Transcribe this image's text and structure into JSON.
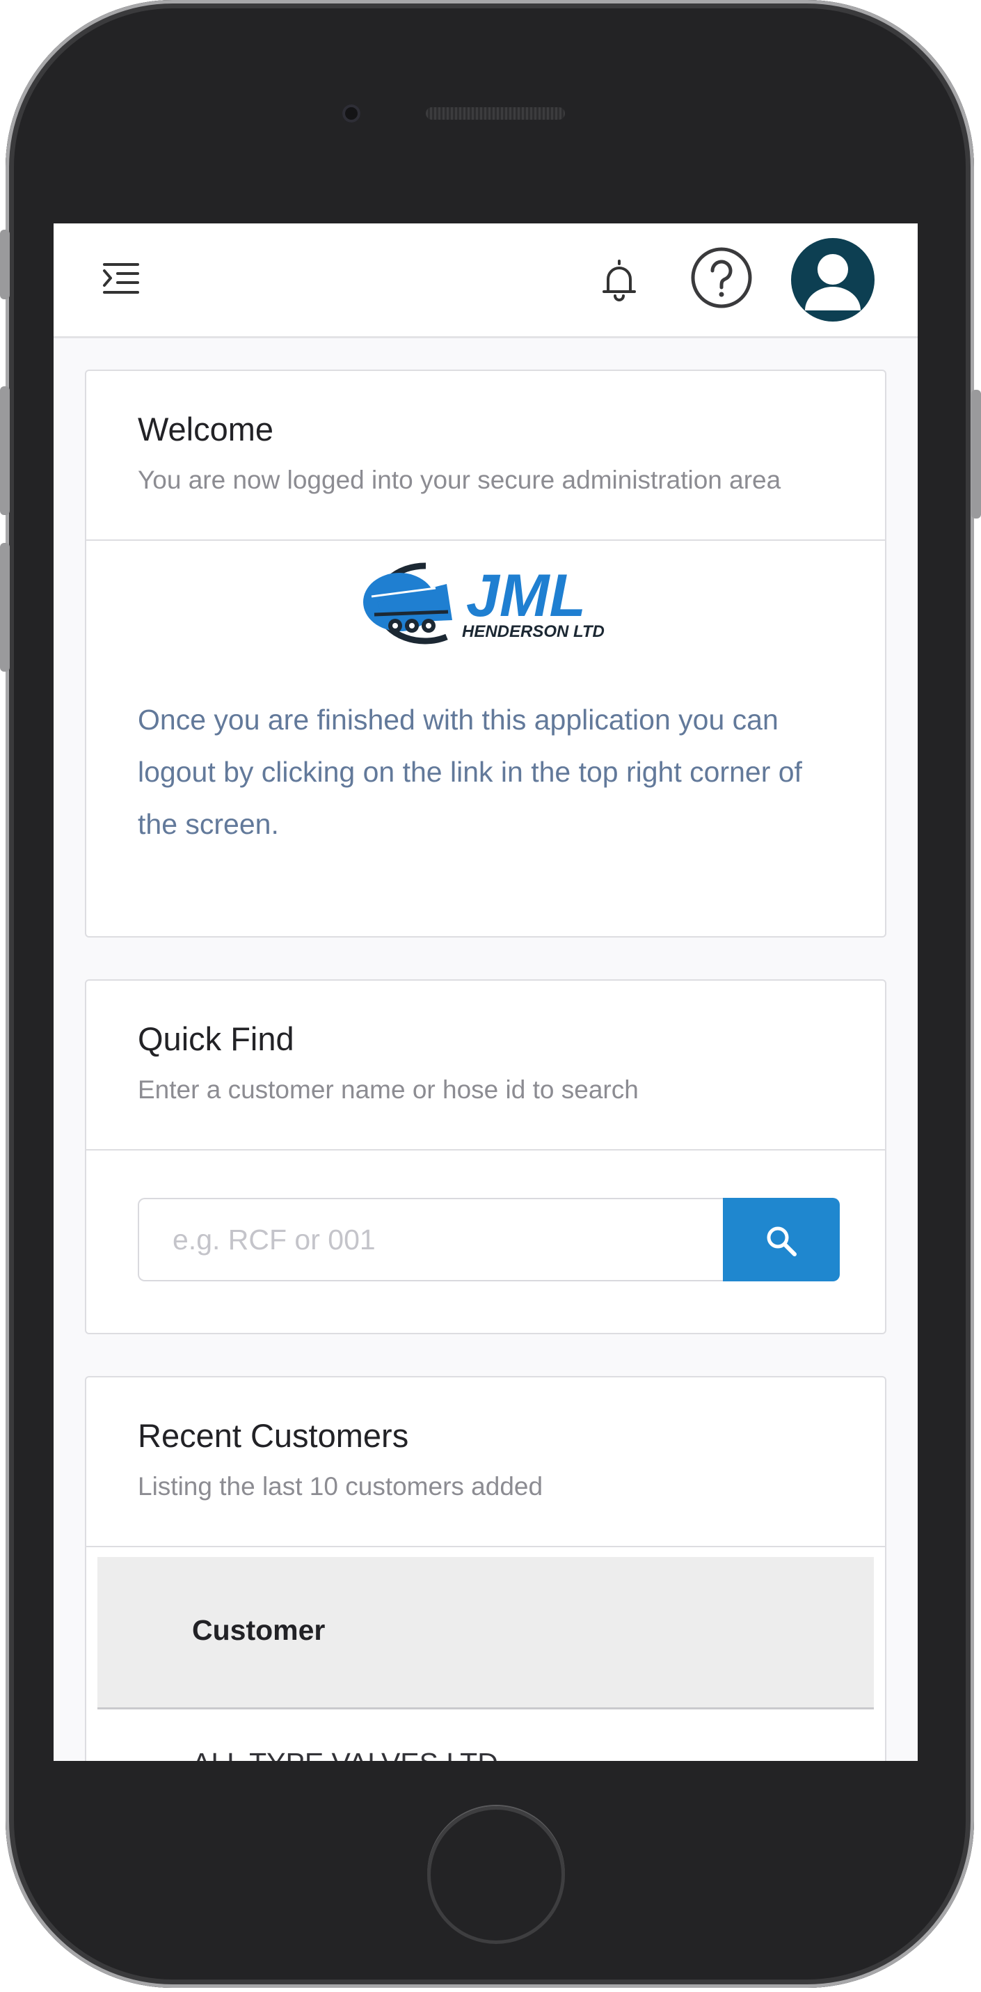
{
  "colors": {
    "accent": "#1f87cf",
    "avatar_bg": "#0d3f52",
    "body_text": "#62799a",
    "logo_blue": "#1f7fd1",
    "logo_dark": "#1c2833"
  },
  "header": {
    "icons": [
      "menu-toggle-icon",
      "bell-icon",
      "help-icon",
      "user-avatar-icon"
    ]
  },
  "welcome": {
    "title": "Welcome",
    "subtitle": "You are now logged into your secure administration area",
    "logo": {
      "main": "JML",
      "sub": "HENDERSON LTD"
    },
    "body": "Once you are finished with this application you can logout by clicking on the link in the top right corner of the screen."
  },
  "quick_find": {
    "title": "Quick Find",
    "subtitle": "Enter a customer name or hose id to search",
    "placeholder": "e.g. RCF or 001",
    "value": "",
    "button_icon": "search-icon"
  },
  "recent": {
    "title": "Recent Customers",
    "subtitle": "Listing the last 10 customers added",
    "columns": [
      "Customer"
    ],
    "rows": [
      {
        "customer": "ALL TYPE VALVES LTD"
      }
    ]
  }
}
